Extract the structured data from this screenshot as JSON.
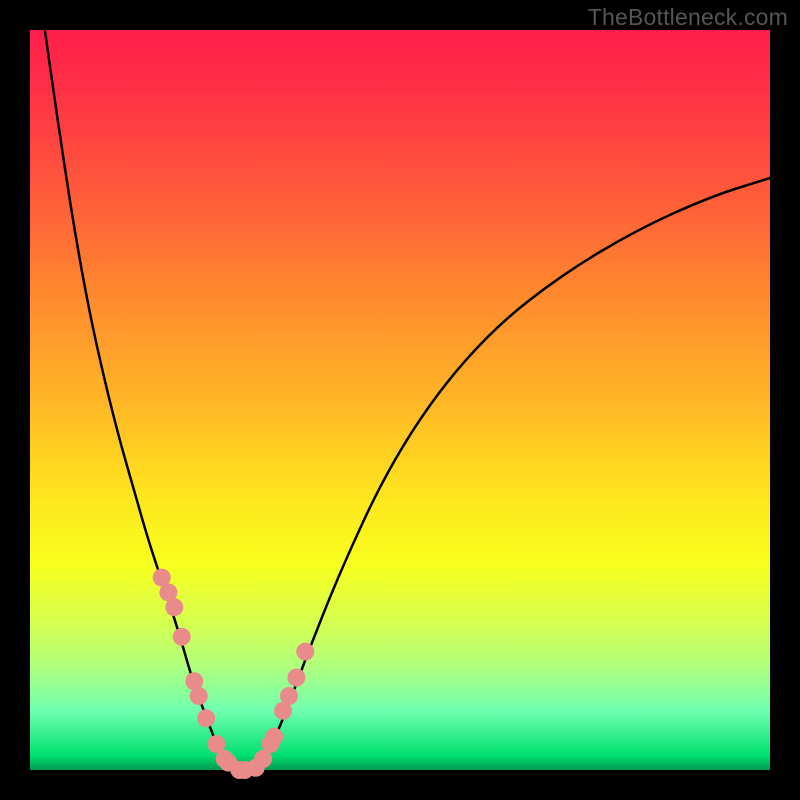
{
  "watermark": "TheBottleneck.com",
  "colors": {
    "curve_stroke": "#000000",
    "point_fill": "#e98b8b",
    "point_stroke": "#c95f5f"
  },
  "chart_data": {
    "type": "line",
    "title": "",
    "xlabel": "",
    "ylabel": "",
    "xlim": [
      0,
      100
    ],
    "ylim": [
      0,
      100
    ],
    "grid": false,
    "legend": false,
    "series": [
      {
        "name": "bottleneck-curve-left",
        "x": [
          2,
          4,
          6,
          8,
          10,
          12,
          14,
          16,
          18,
          20,
          22,
          23.5,
          25,
          26,
          27
        ],
        "y": [
          100,
          86,
          73,
          62,
          53,
          45,
          38,
          31,
          25,
          19,
          12,
          8,
          4,
          2,
          0.5
        ]
      },
      {
        "name": "bottleneck-curve-bottom",
        "x": [
          27,
          28,
          29,
          30,
          31
        ],
        "y": [
          0.5,
          0,
          0,
          0,
          0.5
        ]
      },
      {
        "name": "bottleneck-curve-right",
        "x": [
          31,
          33,
          35,
          38,
          42,
          48,
          55,
          63,
          72,
          82,
          92,
          100
        ],
        "y": [
          0.5,
          4,
          9,
          17,
          27,
          40,
          51,
          60,
          67,
          73,
          77.5,
          80
        ]
      }
    ],
    "points": {
      "name": "highlighted-samples",
      "x": [
        17.8,
        18.7,
        19.5,
        20.5,
        22.2,
        22.8,
        23.8,
        25.2,
        26.3,
        26.8,
        28.3,
        29.0,
        30.5,
        31.5,
        32.5,
        33.0,
        34.2,
        35.0,
        36.0,
        37.2
      ],
      "y": [
        26,
        24,
        22,
        18,
        12,
        10,
        7,
        3.5,
        1.5,
        1,
        0,
        0,
        0.3,
        1.5,
        3.5,
        4.5,
        8,
        10,
        12.5,
        16
      ]
    }
  }
}
